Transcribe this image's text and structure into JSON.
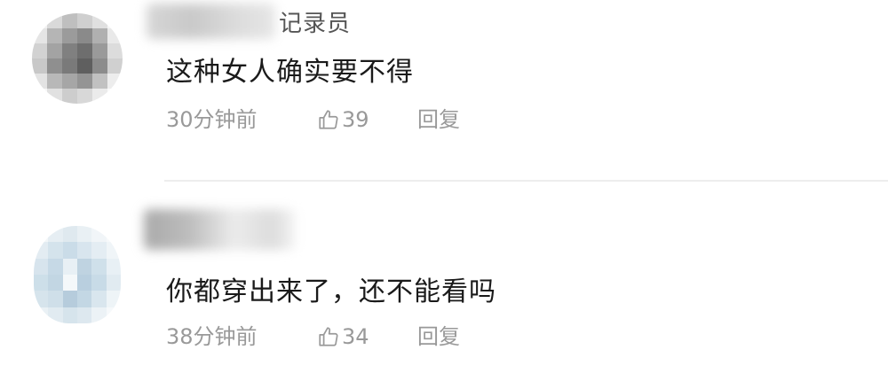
{
  "comments": [
    {
      "username_suffix": "记录员",
      "text": "这种女人确实要不得",
      "time": "30分钟前",
      "likes": "39",
      "reply_label": "回复",
      "avatar_tones": [
        "#f2f2f2",
        "#d9d9d9",
        "#bfbfbf",
        "#cfcfcf",
        "#e0e0e0",
        "#f5f5f5",
        "#e5e5e5",
        "#b5b5b5",
        "#9b9b9b",
        "#8a8a8a",
        "#b0b0b0",
        "#e9e9e9",
        "#d2d2d2",
        "#a3a3a3",
        "#808080",
        "#6e6e6e",
        "#9a9a9a",
        "#dcdcdc",
        "#c8c8c8",
        "#8f8f8f",
        "#7a7a7a",
        "#5f5f5f",
        "#8c8c8c",
        "#d0d0d0",
        "#e3e3e3",
        "#b8b8b8",
        "#a6a6a6",
        "#949494",
        "#c1c1c1",
        "#ededed",
        "#f7f7f7",
        "#e1e1e1",
        "#cdcdcd",
        "#d8d8d8",
        "#ebebeb",
        "#f9f9f9"
      ]
    },
    {
      "username_suffix": "",
      "text": "你都穿出来了，还不能看吗",
      "time": "38分钟前",
      "likes": "34",
      "reply_label": "回复",
      "avatar_tones": [
        "#f3f6f8",
        "#e6eef3",
        "#dfe9ef",
        "#e9f0f4",
        "#f1f5f8",
        "#f7f9fb",
        "#e3ecf2",
        "#d4e3ec",
        "#cadce8",
        "#d8e5ee",
        "#e4edf3",
        "#f0f5f8",
        "#d7e4ed",
        "#c6d9e6",
        "#e8f0f5",
        "#bfd3e1",
        "#cfe0ea",
        "#e8f0f5",
        "#cddfe9",
        "#c2d6e3",
        "#f4f8fa",
        "#b9cfdf",
        "#c8dbe7",
        "#e1ebf1",
        "#d6e4ec",
        "#cfdfe9",
        "#b6ccdc",
        "#c3d7e4",
        "#d9e6ee",
        "#eef4f7",
        "#eaf1f5",
        "#e1ebf1",
        "#d6e4ec",
        "#dde8ef",
        "#ecf2f6",
        "#f6f9fb"
      ]
    }
  ]
}
